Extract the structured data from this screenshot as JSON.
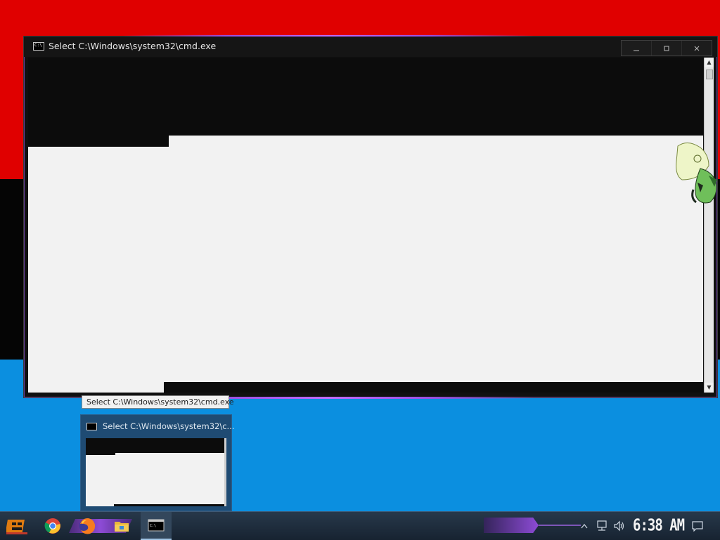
{
  "window": {
    "title": "Select C:\\Windows\\system32\\cmd.exe",
    "controls": [
      "minimize",
      "maximize",
      "close"
    ]
  },
  "tooltip": {
    "text": "Select C:\\Windows\\system32\\cmd.exe"
  },
  "thumbnail": {
    "title": "Select C:\\Windows\\system32\\c..."
  },
  "taskbar": {
    "apps": [
      "start",
      "chrome",
      "firefox",
      "file-explorer",
      "cmd"
    ],
    "active_app": "cmd"
  },
  "tray": {
    "time": "6:38 AM",
    "icons": [
      "show-hidden-icons",
      "network-icon",
      "volume-icon",
      "action-center-icon"
    ]
  },
  "colors": {
    "desktop_red": "#e00000",
    "desktop_black": "#050505",
    "desktop_blue": "#0b8fe0",
    "accent_purple": "#8d4bd6",
    "console_bg": "#0c0c0c",
    "selection_bg": "#f2f2f2"
  }
}
